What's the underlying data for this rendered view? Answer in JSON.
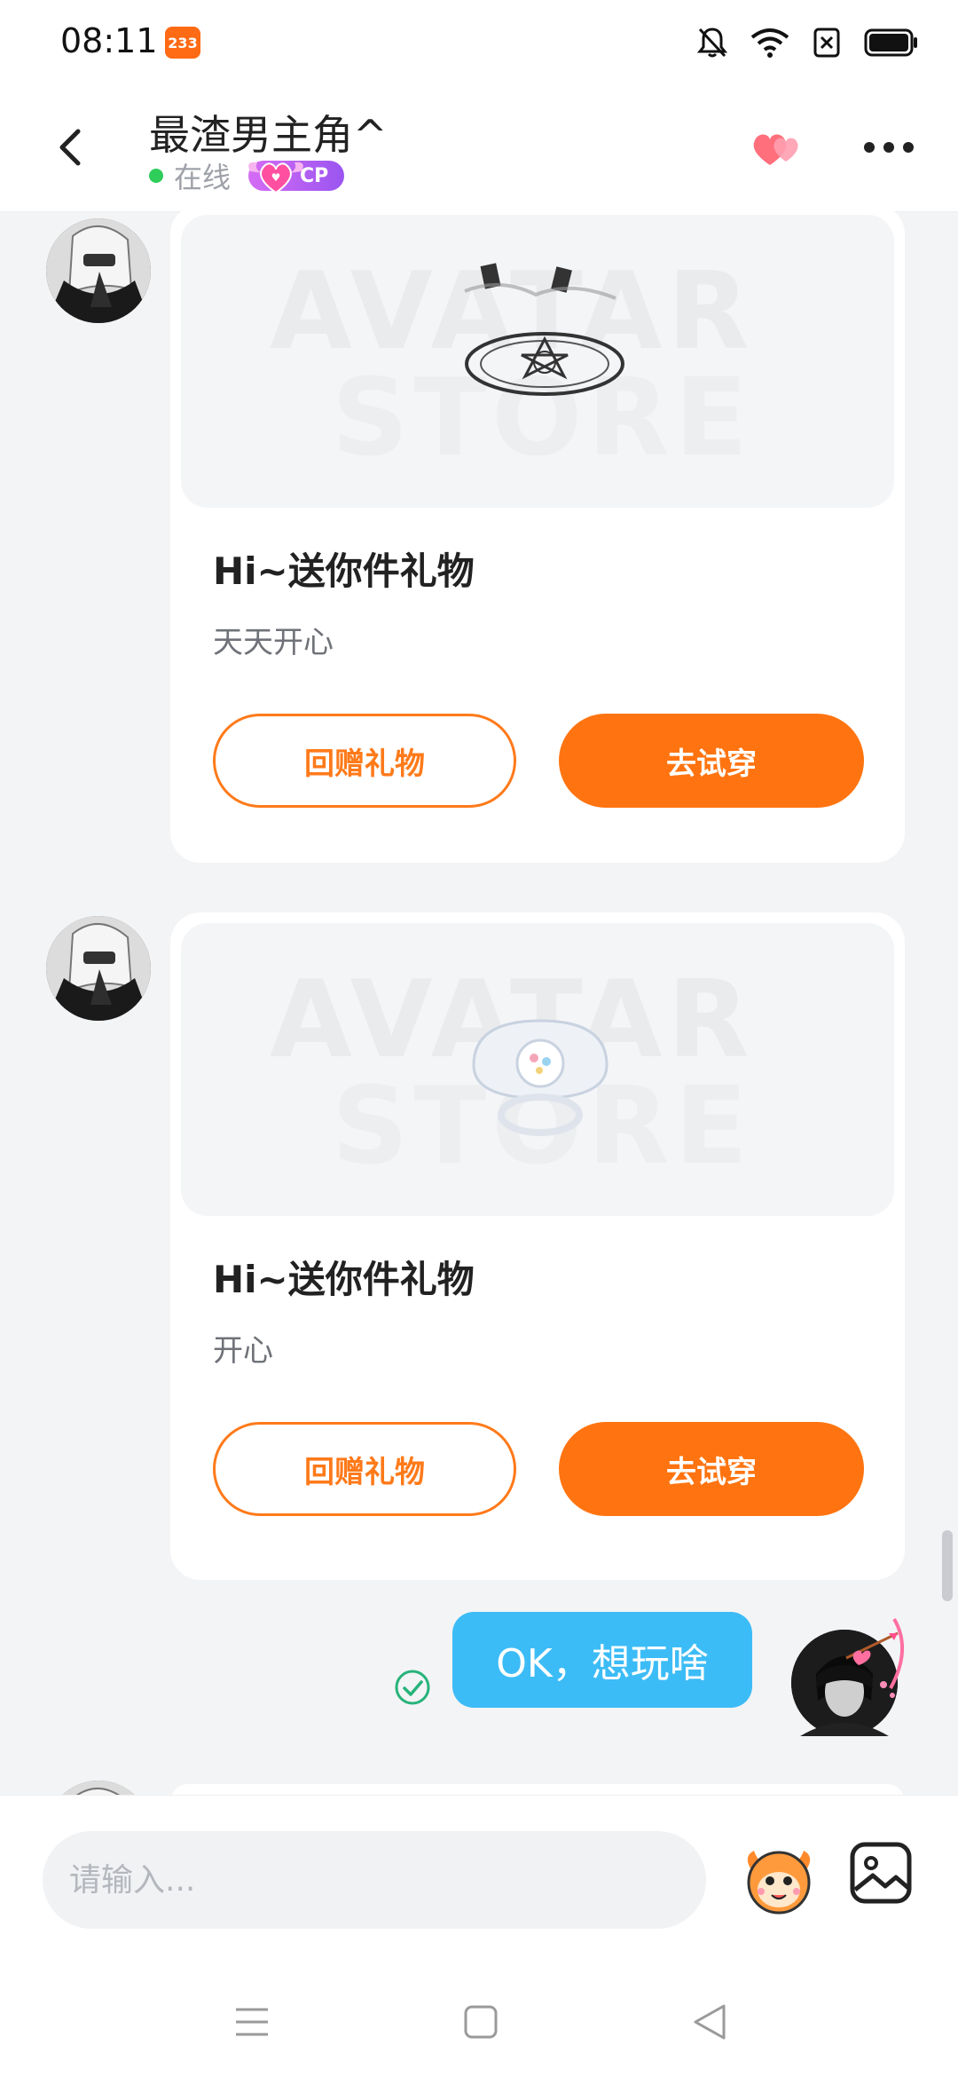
{
  "status_bar": {
    "time": "08:11",
    "notification_badge": "233",
    "icons": [
      "bell-off-icon",
      "wifi-icon",
      "sim-off-icon",
      "battery-icon"
    ]
  },
  "header": {
    "title": "最渣男主角^",
    "status": "在线",
    "cp_badge": "CP",
    "icons": [
      "back-icon",
      "hearts-icon",
      "more-icon"
    ]
  },
  "messages": [
    {
      "type": "gift",
      "image_watermark_line1": "AVATAR",
      "image_watermark_line2": "STORE",
      "title": "Hi~送你件礼物",
      "message": "天天开心",
      "return_gift_label": "回赠礼物",
      "try_on_label": "去试穿"
    },
    {
      "type": "gift",
      "image_watermark_line1": "AVATAR",
      "image_watermark_line2": "STORE",
      "title": "Hi~送你件礼物",
      "message": "开心",
      "return_gift_label": "回赠礼物",
      "try_on_label": "去试穿"
    },
    {
      "type": "sent_text",
      "text": "OK，想玩啥",
      "status_icon": "check-circle-icon"
    }
  ],
  "input_bar": {
    "placeholder": "请输入...",
    "icons": [
      "emoji-mascot-icon",
      "image-icon"
    ]
  },
  "colors": {
    "accent_orange": "#ff7410",
    "sent_bubble": "#3cbcf6",
    "online": "#2fcd59",
    "cp_purple": "#b060f2"
  }
}
